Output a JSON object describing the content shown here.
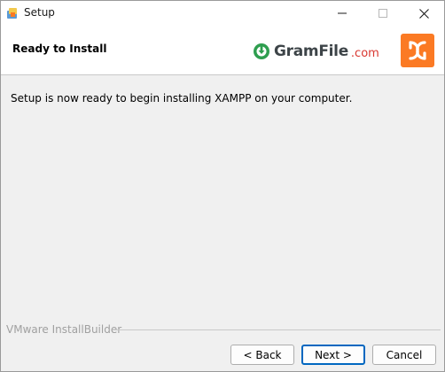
{
  "window": {
    "title": "Setup"
  },
  "header": {
    "title": "Ready to Install",
    "brand_logo_name": "GramFile",
    "brand_logo_domain": ".com",
    "colors": {
      "gram_green": "#2e9e4f",
      "gram_text": "#3d4448",
      "gram_com": "#d9362f",
      "xampp_orange": "#fb7a24"
    }
  },
  "main": {
    "message": "Setup is now ready to begin installing XAMPP on your computer."
  },
  "footer": {
    "builder_label": "VMware InstallBuilder",
    "back_label": "< Back",
    "next_label": "Next >",
    "cancel_label": "Cancel"
  },
  "icons": {
    "app": "xampp-setup-icon",
    "minimize": "minimize-icon",
    "maximize": "maximize-icon",
    "close": "close-icon",
    "gram": "gramfile-download-icon",
    "xampp": "xampp-logo-icon"
  }
}
